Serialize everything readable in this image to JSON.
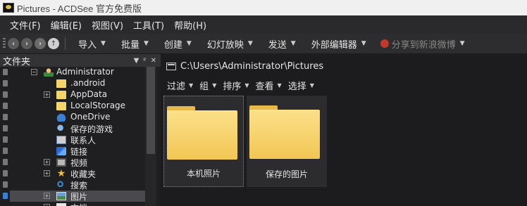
{
  "window": {
    "title": "Pictures - ACDSee 官方免费版"
  },
  "menu": [
    "文件(F)",
    "编辑(E)",
    "视图(V)",
    "工具(T)",
    "帮助(H)"
  ],
  "toolbar": {
    "import": "导入",
    "batch": "批量",
    "create": "创建",
    "slideshow": "幻灯放映",
    "send": "发送",
    "external_editor": "外部编辑器",
    "share_weibo": "分享到新浪微博"
  },
  "folders_panel": {
    "title": "文件夹",
    "tree": [
      {
        "label": "Administrator",
        "icon": "user-icon",
        "expander": "−",
        "selected": false
      },
      {
        "label": ".android",
        "icon": "folder-icon",
        "expander": "",
        "selected": false
      },
      {
        "label": "AppData",
        "icon": "folder-icon",
        "expander": "+",
        "selected": false
      },
      {
        "label": "LocalStorage",
        "icon": "folder-icon",
        "expander": "",
        "selected": false
      },
      {
        "label": "OneDrive",
        "icon": "cloud-icon",
        "expander": "",
        "selected": false
      },
      {
        "label": "保存的游戏",
        "icon": "game-icon",
        "expander": "",
        "selected": false
      },
      {
        "label": "联系人",
        "icon": "contact-icon",
        "expander": "",
        "selected": false
      },
      {
        "label": "链接",
        "icon": "link-icon",
        "expander": "",
        "selected": false
      },
      {
        "label": "视频",
        "icon": "video-icon",
        "expander": "+",
        "selected": false
      },
      {
        "label": "收藏夹",
        "icon": "star-icon",
        "expander": "+",
        "selected": false
      },
      {
        "label": "搜索",
        "icon": "search-icon",
        "expander": "",
        "selected": false
      },
      {
        "label": "图片",
        "icon": "picture-icon",
        "expander": "+",
        "selected": true
      },
      {
        "label": "文档",
        "icon": "document-icon",
        "expander": "+",
        "selected": false
      }
    ]
  },
  "browser": {
    "path": "C:\\Users\\Administrator\\Pictures",
    "filters": [
      "过滤",
      "组",
      "排序",
      "查看",
      "选择"
    ],
    "items": [
      {
        "label": "本机照片",
        "type": "folder"
      },
      {
        "label": "保存的图片",
        "type": "folder"
      }
    ]
  }
}
